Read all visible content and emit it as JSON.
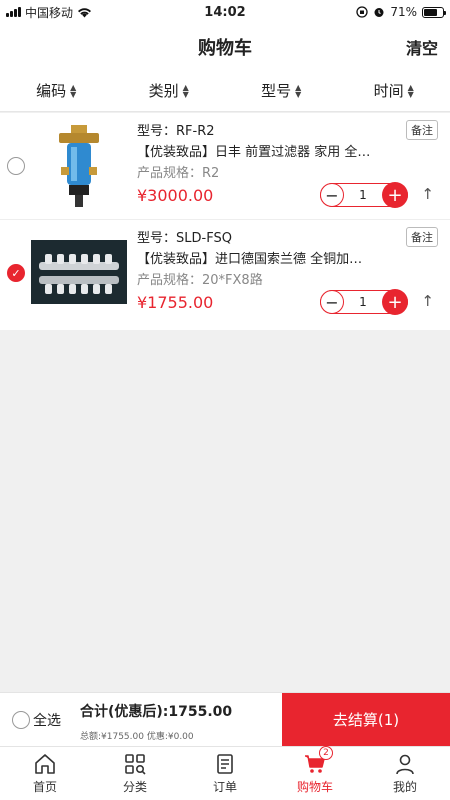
{
  "status_bar": {
    "carrier": "中国移动",
    "time": "14:02",
    "battery": "71%"
  },
  "nav": {
    "title": "购物车",
    "clear_label": "清空"
  },
  "sort_bar": [
    "编码",
    "类别",
    "型号",
    "时间"
  ],
  "items": [
    {
      "model": "型号：RF-R2",
      "title": "【优装致品】日丰 前置过滤器 家用 全…",
      "spec": "产品规格：R2",
      "price": "¥3000.00",
      "note_label": "备注",
      "quantity": "1",
      "selected": false
    },
    {
      "model": "型号：SLD-FSQ",
      "title": "【优装致品】进口德国索兰德 全铜加…",
      "spec": "产品规格：20*FX8路",
      "price": "¥1755.00",
      "note_label": "备注",
      "quantity": "1",
      "selected": true
    }
  ],
  "checkout": {
    "select_all_label": "全选",
    "total": "合计(优惠后):1755.00",
    "detail": "总额:¥1755.00 优惠:¥0.00",
    "button_label": "去结算(1)"
  },
  "tabbar": {
    "tabs": [
      {
        "label": "首页",
        "icon": "home-icon"
      },
      {
        "label": "分类",
        "icon": "category-icon"
      },
      {
        "label": "订单",
        "icon": "order-icon"
      },
      {
        "label": "购物车",
        "icon": "cart-icon",
        "badge": "2",
        "active": true
      },
      {
        "label": "我的",
        "icon": "profile-icon"
      }
    ]
  },
  "colors": {
    "accent": "#e8252f"
  }
}
